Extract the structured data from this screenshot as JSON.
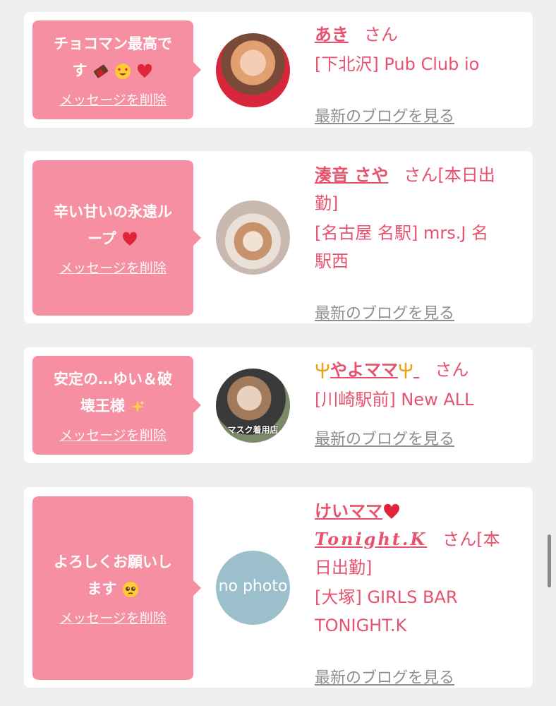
{
  "colors": {
    "accent": "#e8526f",
    "bubble": "#f68fa2",
    "gray_link": "#8e8e8e",
    "background": "#efeff0"
  },
  "items": [
    {
      "message_line1": "チョコマン最高で",
      "message_line2": "す",
      "delete_label": "メッセージを削除",
      "name": "あき",
      "suffix": "さん",
      "shop": "[下北沢] Pub Club io",
      "blog_label": "最新のブログを見る"
    },
    {
      "message_line1": "辛い甘いの永遠ル",
      "message_line2": "ープ",
      "delete_label": "メッセージを削除",
      "name": "湊音 さや",
      "suffix": "さん[本日出",
      "suffix_line2": "勤]",
      "shop_line1": "[名古屋 名駅] mrs.J 名",
      "shop_line2": "駅西",
      "blog_label": "最新のブログを見る"
    },
    {
      "message_line1": "安定の…ゆい＆破",
      "message_line2": "壊王様",
      "delete_label": "メッセージを削除",
      "name": "やよママ",
      "suffix": "さん",
      "shop": "[川崎駅前] New ALL",
      "avatar_caption": "マスク着用店",
      "blog_label": "最新のブログを見る"
    },
    {
      "message_line1": "よろしくお願いし",
      "message_line2": "ます",
      "delete_label": "メッセージを削除",
      "name_line1": "けいママ",
      "name_line2": "Tonight.K",
      "suffix": "さん[本",
      "suffix_line2": "日出勤]",
      "shop_line1": "[大塚] GIRLS BAR",
      "shop_line2": "TONIGHT.K",
      "avatar_placeholder": "no photo",
      "blog_label": "最新のブログを見る"
    }
  ]
}
